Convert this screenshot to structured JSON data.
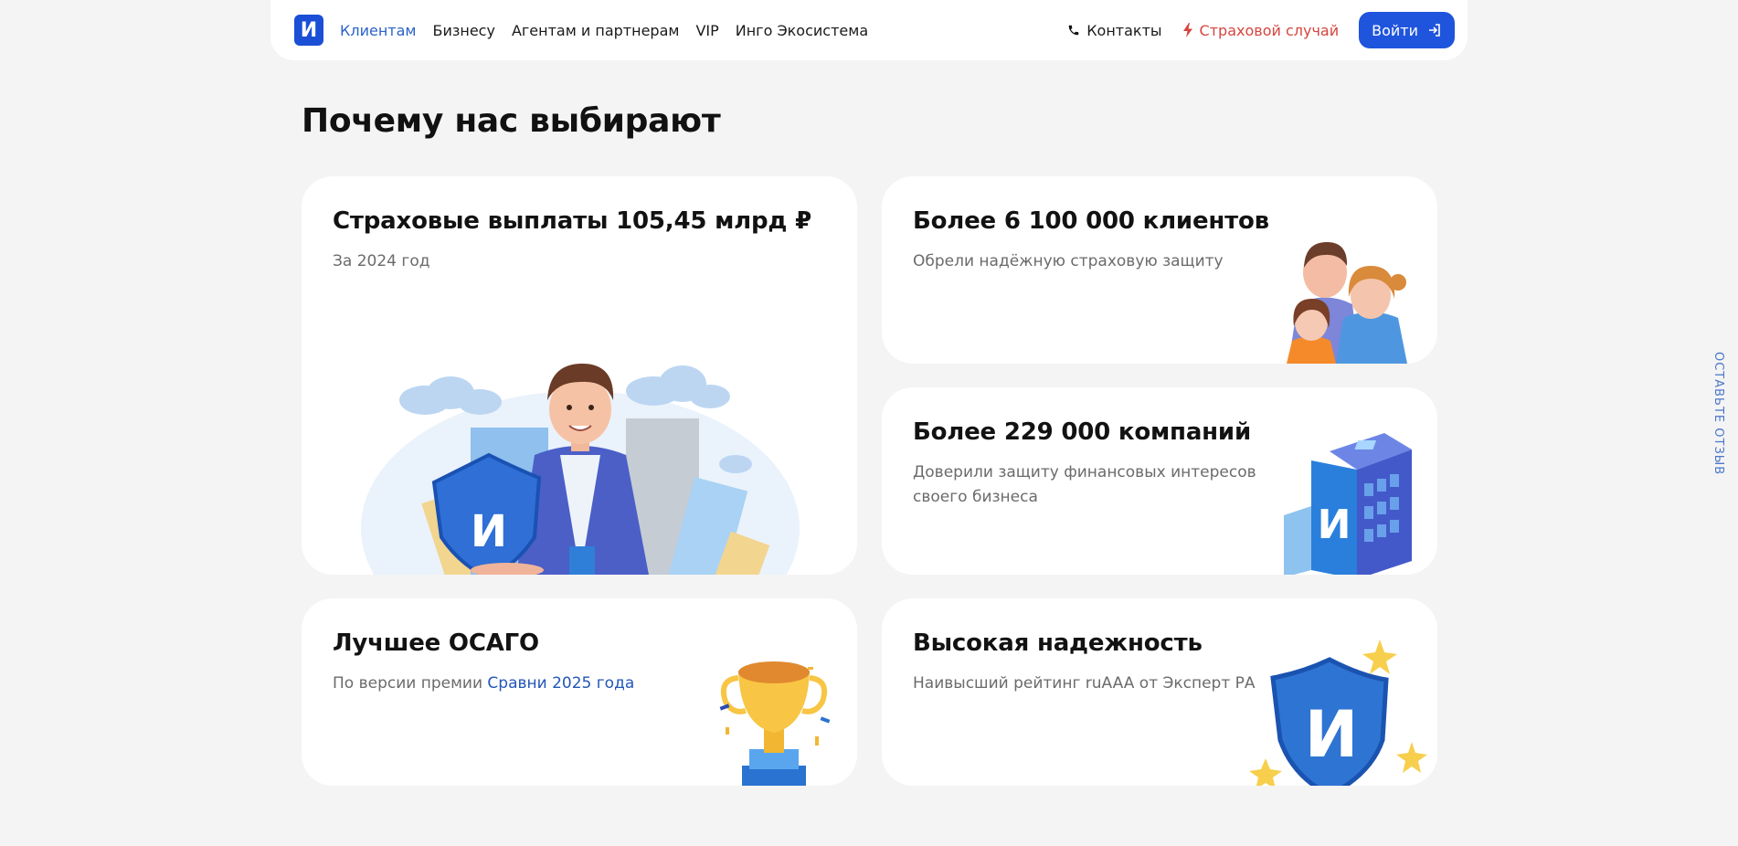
{
  "header": {
    "logo_letter": "И",
    "nav": [
      {
        "label": "Клиентам",
        "active": true
      },
      {
        "label": "Бизнесу",
        "active": false
      },
      {
        "label": "Агентам и партнерам",
        "active": false
      },
      {
        "label": "VIP",
        "active": false
      },
      {
        "label": "Инго Экосистема",
        "active": false
      }
    ],
    "contacts_label": "Контакты",
    "claim_label": "Страховой случай",
    "login_label": "Войти"
  },
  "section_title": "Почему нас выбирают",
  "cards": [
    {
      "title": "Страховые выплаты 105,45 млрд ₽",
      "subtitle": "За 2024 год"
    },
    {
      "title": "Более 6 100 000 клиентов",
      "subtitle": "Обрели надёжную страховую защиту"
    },
    {
      "title": "Более 229 000 компаний",
      "subtitle_line1": "Доверили защиту финансовых интересов",
      "subtitle_line2": "своего бизнеса"
    },
    {
      "title": "Лучшее ОСАГО",
      "subtitle_prefix": "По версии премии ",
      "subtitle_link": "Сравни 2025 года"
    },
    {
      "title": "Высокая надежность",
      "subtitle": "Наивысший рейтинг ruAAA от Эксперт РА"
    }
  ],
  "feedback_tab": "ОСТАВЬТЕ ОТЗЫВ",
  "colors": {
    "brand": "#1f55dc",
    "accent_link": "#2356b8",
    "claim": "#d6443e"
  },
  "icons": [
    "phone-icon",
    "lightning-icon",
    "login-arrow-icon",
    "shield-logo-icon",
    "trophy-icon",
    "building-icon",
    "people-icon"
  ]
}
